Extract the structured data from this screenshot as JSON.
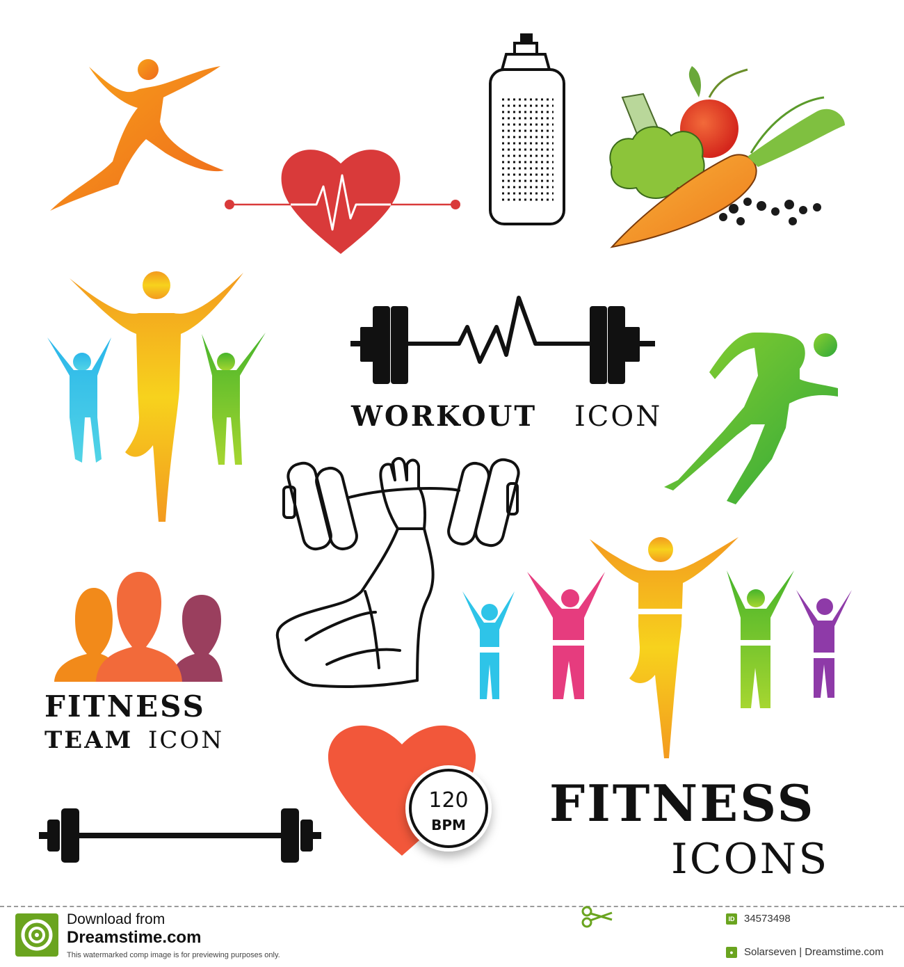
{
  "labels": {
    "workout_bold": "WORKOUT",
    "workout_light": "ICON",
    "team_line1": "FITNESS",
    "team_line2_bold": "TEAM",
    "team_line2_light": "ICON",
    "bpm_value": "120",
    "bpm_unit": "BPM",
    "big_title": "FITNESS",
    "big_subtitle": "ICONS"
  },
  "footer": {
    "download_line1": "Download from",
    "download_line2": "Dreamstime.com",
    "watermark_note": "This watermarked comp image is for previewing purposes only.",
    "cut_word": "FITNESS",
    "id_label": "ID",
    "id_value": "34573498",
    "author_value": "Solarseven | Dreamstime.com"
  },
  "colors": {
    "orange": "#f07d1a",
    "red_heart": "#d93a3a",
    "coral_heart": "#f2573a",
    "green": "#55b82c",
    "cyan": "#2ec4e8",
    "magenta": "#e63c7e",
    "purple": "#8e3aa8",
    "yellow": "#f5b21a",
    "black": "#111111",
    "dreamstime_green": "#6aa41f"
  },
  "icons": [
    "jumping-person-icon",
    "heartbeat-heart-icon",
    "water-bottle-icon",
    "vegetables-icon",
    "celebrating-team-icon",
    "workout-barbell-pulse-icon",
    "running-person-icon",
    "arm-lifting-dumbbell-icon",
    "fitness-team-heads-icon",
    "cheering-group-icon",
    "barbell-icon",
    "heart-bpm-icon",
    "scissors-icon"
  ]
}
